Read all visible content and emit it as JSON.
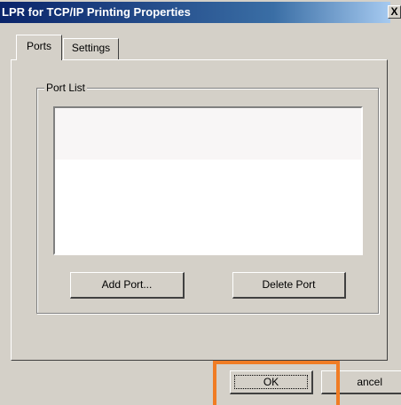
{
  "window": {
    "title": "LPR for TCP/IP Printing Properties",
    "close_glyph": "X"
  },
  "tabs": [
    {
      "label": "Ports",
      "active": true
    },
    {
      "label": "Settings",
      "active": false
    }
  ],
  "port_list": {
    "group_label": "Port List",
    "items": []
  },
  "buttons": {
    "add_port": "Add Port...",
    "delete_port": "Delete Port",
    "ok": "OK",
    "cancel": "Cancel",
    "cancel_visible": "ancel"
  },
  "colors": {
    "title_bar": "#0a246a",
    "face": "#d4d0c8",
    "highlight_annotation": "#f07c24"
  }
}
